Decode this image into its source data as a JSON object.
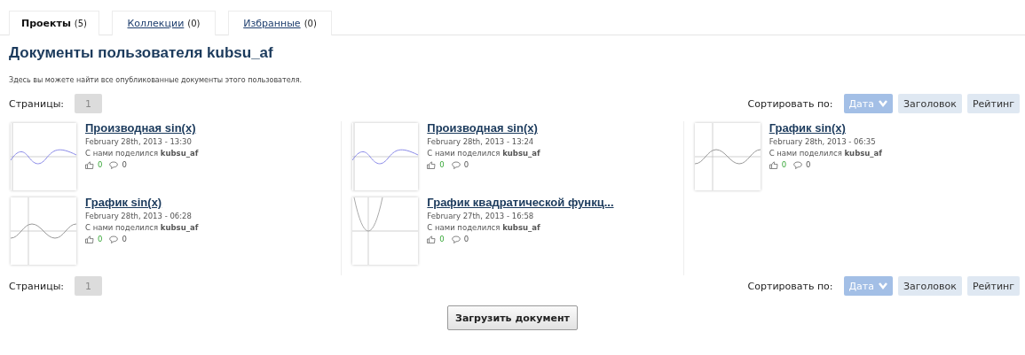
{
  "tabs": [
    {
      "label": "Проекты",
      "count": "(5)",
      "selected": true
    },
    {
      "label": "Коллекции",
      "count": "(0)",
      "selected": false
    },
    {
      "label": "Избранные",
      "count": "(0)",
      "selected": false
    }
  ],
  "heading": "Документы пользователя kubsu_af",
  "description": "Здесь вы можете найти все опубликованные документы этого пользователя.",
  "top_bar": {
    "pager": {
      "label": "Страницы:",
      "pages": [
        {
          "label": "1",
          "selected": true
        }
      ]
    },
    "sort": {
      "label": "Сортировать по:",
      "options": [
        {
          "label": "Дата",
          "selected": true
        },
        {
          "label": "Заголовок",
          "selected": false
        },
        {
          "label": "Рейтинг",
          "selected": false
        }
      ]
    }
  },
  "columns": [
    {
      "documents": [
        {
          "title": "Производная sin(x)",
          "date": "February 28th, 2013 - 13:30",
          "shared": "С нами поделился **kubsu_af**",
          "likes": "0",
          "comments": "0",
          "thumbnail": {
            "kind": "blue-wave"
          }
        },
        {
          "title": "График sin(x)",
          "date": "February 28th, 2013 - 06:28",
          "shared": "С нами поделился **kubsu_af**",
          "likes": "0",
          "comments": "0",
          "thumbnail": {
            "kind": "gray-wave"
          }
        }
      ]
    },
    {
      "documents": [
        {
          "title": "Производная sin(x)",
          "date": "February 28th, 2013 - 13:24",
          "shared": "С нами поделился **kubsu_af**",
          "likes": "0",
          "comments": "0",
          "thumbnail": {
            "kind": "blue-wave"
          }
        },
        {
          "title": "График квадратической функц...",
          "date": "February 27th, 2013 - 16:58",
          "shared": "С нами поделился **kubsu_af**",
          "likes": "0",
          "comments": "0",
          "thumbnail": {
            "kind": "parabola"
          }
        }
      ]
    },
    {
      "documents": [
        {
          "title": "График sin(x)",
          "date": "February 28th, 2013 - 06:35",
          "shared": "С нами поделился **kubsu_af**",
          "likes": "0",
          "comments": "0",
          "thumbnail": {
            "kind": "gray-wave"
          }
        }
      ]
    }
  ],
  "bottom_bar": {
    "pager": {
      "label": "Страницы:",
      "pages": [
        {
          "label": "1",
          "selected": true
        }
      ]
    },
    "sort": {
      "label": "Сортировать по:",
      "options": [
        {
          "label": "Дата",
          "selected": true
        },
        {
          "label": "Заголовок",
          "selected": false
        },
        {
          "label": "Рейтинг",
          "selected": false
        }
      ]
    }
  },
  "upload_button": "Загрузить документ"
}
